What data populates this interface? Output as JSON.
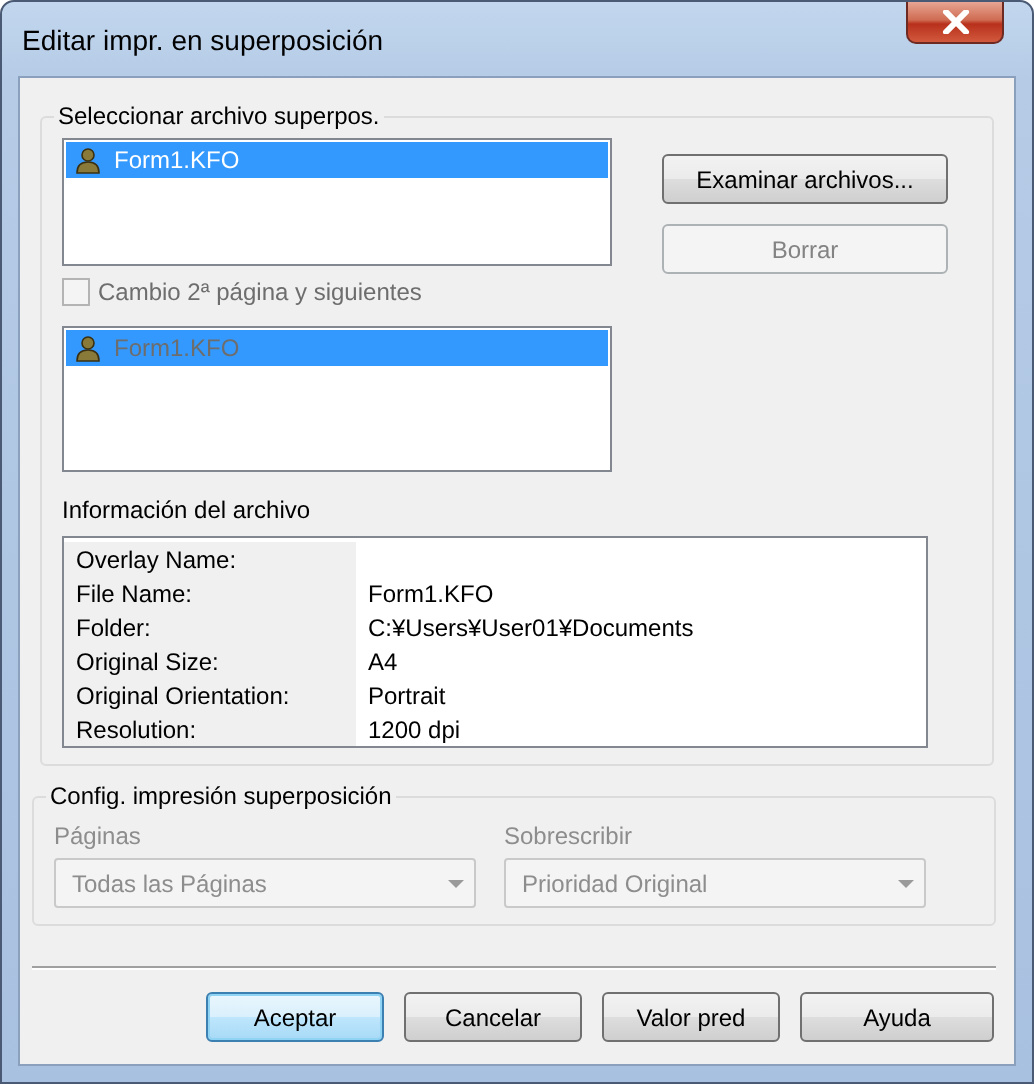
{
  "window": {
    "title": "Editar impr. en superposición"
  },
  "overlay_group": {
    "title": "Seleccionar archivo superpos.",
    "file_list": [
      {
        "name": "Form1.KFO",
        "selected": true
      }
    ],
    "buttons": [
      {
        "label": "Examinar archivos...",
        "disabled": false
      },
      {
        "label": "Borrar",
        "disabled": true
      }
    ],
    "second_page_checkbox": {
      "label": "Cambio 2ª página y siguientes",
      "checked": false,
      "disabled": true
    },
    "second_page_list": [
      {
        "name": "Form1.KFO",
        "selected": true,
        "disabled": true
      }
    ],
    "file_info": {
      "title": "Información del archivo",
      "rows": [
        {
          "label": "Overlay Name:"
        },
        {
          "label": "File Name:",
          "value": "Form1.KFO"
        },
        {
          "label": "Folder:",
          "value": "C:¥Users¥User01¥Documents"
        },
        {
          "label": "Original Size:",
          "value": "A4"
        },
        {
          "label": "Original Orientation:",
          "value": "Portrait"
        },
        {
          "label": "Resolution:",
          "value": "1200 dpi"
        }
      ]
    }
  },
  "print_settings": {
    "title": "Config. impresión superposición",
    "disabled": true,
    "fields": [
      {
        "label": "Páginas",
        "value": "Todas las Páginas"
      },
      {
        "label": "Sobrescribir",
        "value": "Prioridad Original"
      }
    ]
  },
  "buttons": [
    {
      "label": "Aceptar",
      "default": true
    },
    {
      "label": "Cancelar",
      "default": false
    },
    {
      "label": "Valor pred",
      "default": false
    },
    {
      "label": "Ayuda",
      "default": false
    }
  ]
}
